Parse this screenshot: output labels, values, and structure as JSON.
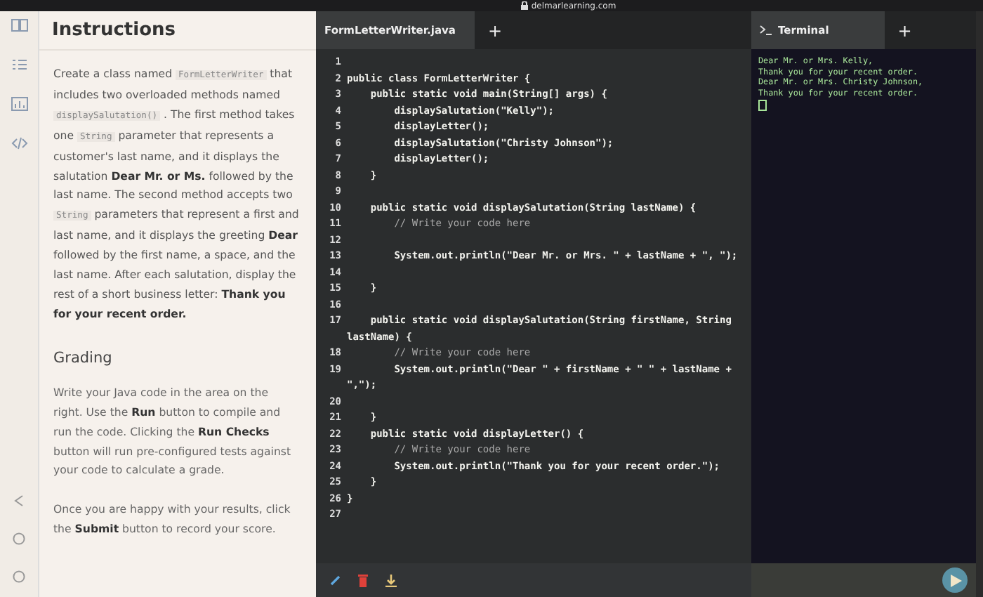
{
  "browser": {
    "url": "delmarlearning.com"
  },
  "instructions": {
    "title": "Instructions",
    "paragraphs": [
      [
        {
          "kind": "text",
          "text": "Create a class named "
        },
        {
          "kind": "code",
          "text": "FormLetterWriter"
        },
        {
          "kind": "text",
          "text": " that includes two overloaded methods named "
        },
        {
          "kind": "code",
          "text": "displaySalutation()"
        },
        {
          "kind": "text",
          "text": " . The first method takes one "
        },
        {
          "kind": "code",
          "text": "String"
        },
        {
          "kind": "text",
          "text": " parameter that represents a customer's last name, and it displays the salutation "
        },
        {
          "kind": "bold",
          "text": "Dear Mr. or Ms."
        },
        {
          "kind": "text",
          "text": " followed by the last name. The second method accepts two "
        },
        {
          "kind": "code",
          "text": "String"
        },
        {
          "kind": "text",
          "text": " parameters that represent a first and last name, and it displays the greeting "
        },
        {
          "kind": "bold",
          "text": "Dear"
        },
        {
          "kind": "text",
          "text": " followed by the first name, a space, and the last name. After each salutation, display the rest of a short business letter: "
        },
        {
          "kind": "bold",
          "text": "Thank you for your recent order."
        }
      ]
    ],
    "grading_title": "Grading",
    "grading_paragraphs": [
      [
        {
          "kind": "text",
          "text": "Write your Java code in the area on the right. Use the "
        },
        {
          "kind": "bold",
          "text": "Run"
        },
        {
          "kind": "text",
          "text": " button to compile and run the code. Clicking the "
        },
        {
          "kind": "bold",
          "text": "Run Checks"
        },
        {
          "kind": "text",
          "text": " button will run pre-configured tests against your code to calculate a grade."
        }
      ],
      [
        {
          "kind": "text",
          "text": "Once you are happy with your results, click the "
        },
        {
          "kind": "bold",
          "text": "Submit"
        },
        {
          "kind": "text",
          "text": " button to record your score."
        }
      ]
    ]
  },
  "editor": {
    "tabs": [
      {
        "label": "FormLetterWriter.java",
        "selected": true
      }
    ],
    "add_tab": "+",
    "lines": [
      {
        "number": "1"
      },
      {
        "number": "2",
        "kind": "code",
        "text": "public class FormLetterWriter {"
      },
      {
        "number": "3",
        "kind": "code",
        "text": "    public static void main(String[] args) {"
      },
      {
        "number": "4",
        "kind": "code",
        "text": "        displaySalutation(\"Kelly\");"
      },
      {
        "number": "5",
        "kind": "code",
        "text": "        displayLetter();"
      },
      {
        "number": "6",
        "kind": "code",
        "text": "        displaySalutation(\"Christy Johnson\");"
      },
      {
        "number": "7",
        "kind": "code",
        "text": "        displayLetter();"
      },
      {
        "number": "8",
        "kind": "code",
        "text": "    }"
      },
      {
        "number": "9"
      },
      {
        "number": "10",
        "kind": "code",
        "text": "    public static void displaySalutation(String lastName) {"
      },
      {
        "number": "11",
        "kind": "comment",
        "text": "        // Write your code here"
      },
      {
        "number": "12"
      },
      {
        "number": "13",
        "kind": "code",
        "text": "        System.out.println(\"Dear Mr. or Mrs. \" + lastName + \", \");"
      },
      {
        "number": "14"
      },
      {
        "number": "15",
        "kind": "code",
        "text": "    }"
      },
      {
        "number": "16"
      },
      {
        "number": "17",
        "kind": "code",
        "text": "    public static void displaySalutation(String firstName, String lastName) {"
      },
      {
        "number": "18",
        "kind": "comment",
        "text": "        // Write your code here"
      },
      {
        "number": "19",
        "kind": "code",
        "text": "        System.out.println(\"Dear \" + firstName + \" \" + lastName + \",\");"
      },
      {
        "number": "20"
      },
      {
        "number": "21",
        "kind": "code",
        "text": "    }"
      },
      {
        "number": "22",
        "kind": "code",
        "text": "    public static void displayLetter() {"
      },
      {
        "number": "23",
        "kind": "comment",
        "text": "        // Write your code here"
      },
      {
        "number": "24",
        "kind": "code",
        "text": "        System.out.println(\"Thank you for your recent order.\");"
      },
      {
        "number": "25",
        "kind": "code",
        "text": "    }"
      },
      {
        "number": "26",
        "kind": "code",
        "text": "}"
      },
      {
        "number": "27"
      }
    ]
  },
  "terminal": {
    "tabs": [
      {
        "label": "Terminal",
        "selected": true
      }
    ],
    "add_tab": "+",
    "output": [
      "Dear Mr. or Mrs. Kelly,",
      "Thank you for your recent order.",
      "Dear Mr. or Mrs. Christy Johnson,",
      "Thank you for your recent order."
    ]
  }
}
